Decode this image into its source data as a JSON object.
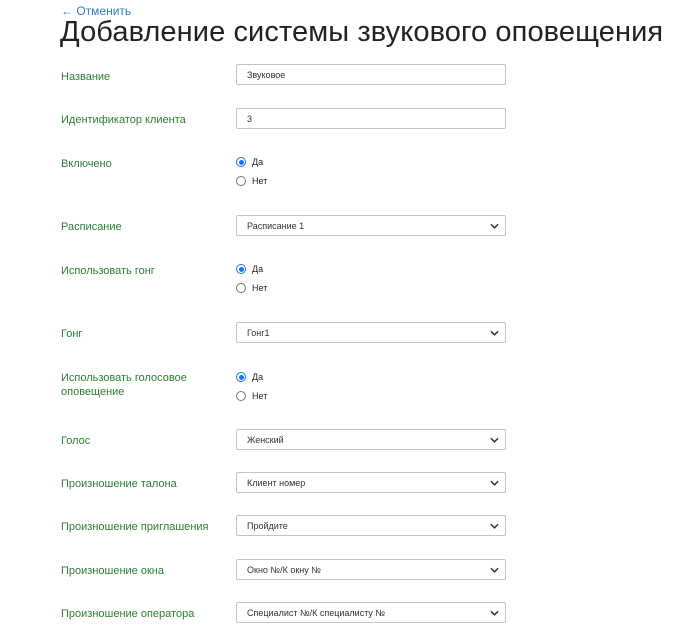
{
  "back_link": "← Отменить",
  "title": "Добавление системы звукового оповещения",
  "fields": {
    "name": {
      "label": "Название",
      "value": "Звуковое"
    },
    "client_id": {
      "label": "Идентификатор клиента",
      "value": "3"
    },
    "enabled": {
      "label": "Включено",
      "options": [
        "Да",
        "Нет"
      ],
      "selected": "Да"
    },
    "schedule": {
      "label": "Расписание",
      "value": "Расписание 1"
    },
    "use_gong": {
      "label": "Использовать гонг",
      "options": [
        "Да",
        "Нет"
      ],
      "selected": "Да"
    },
    "gong": {
      "label": "Гонг",
      "value": "Гонг1"
    },
    "use_voice": {
      "label": "Использовать голосовое оповещение",
      "options": [
        "Да",
        "Нет"
      ],
      "selected": "Да"
    },
    "voice": {
      "label": "Голос",
      "value": "Женский"
    },
    "ticket_pron": {
      "label": "Произношение талона",
      "value": "Клиент номер"
    },
    "invite_pron": {
      "label": "Произношение приглашения",
      "value": "Пройдите"
    },
    "window_pron": {
      "label": "Произношение окна",
      "value": "Окно №/К окну №"
    },
    "operator_pron": {
      "label": "Произношение оператора",
      "value": "Специалист №/К специалисту №"
    }
  }
}
